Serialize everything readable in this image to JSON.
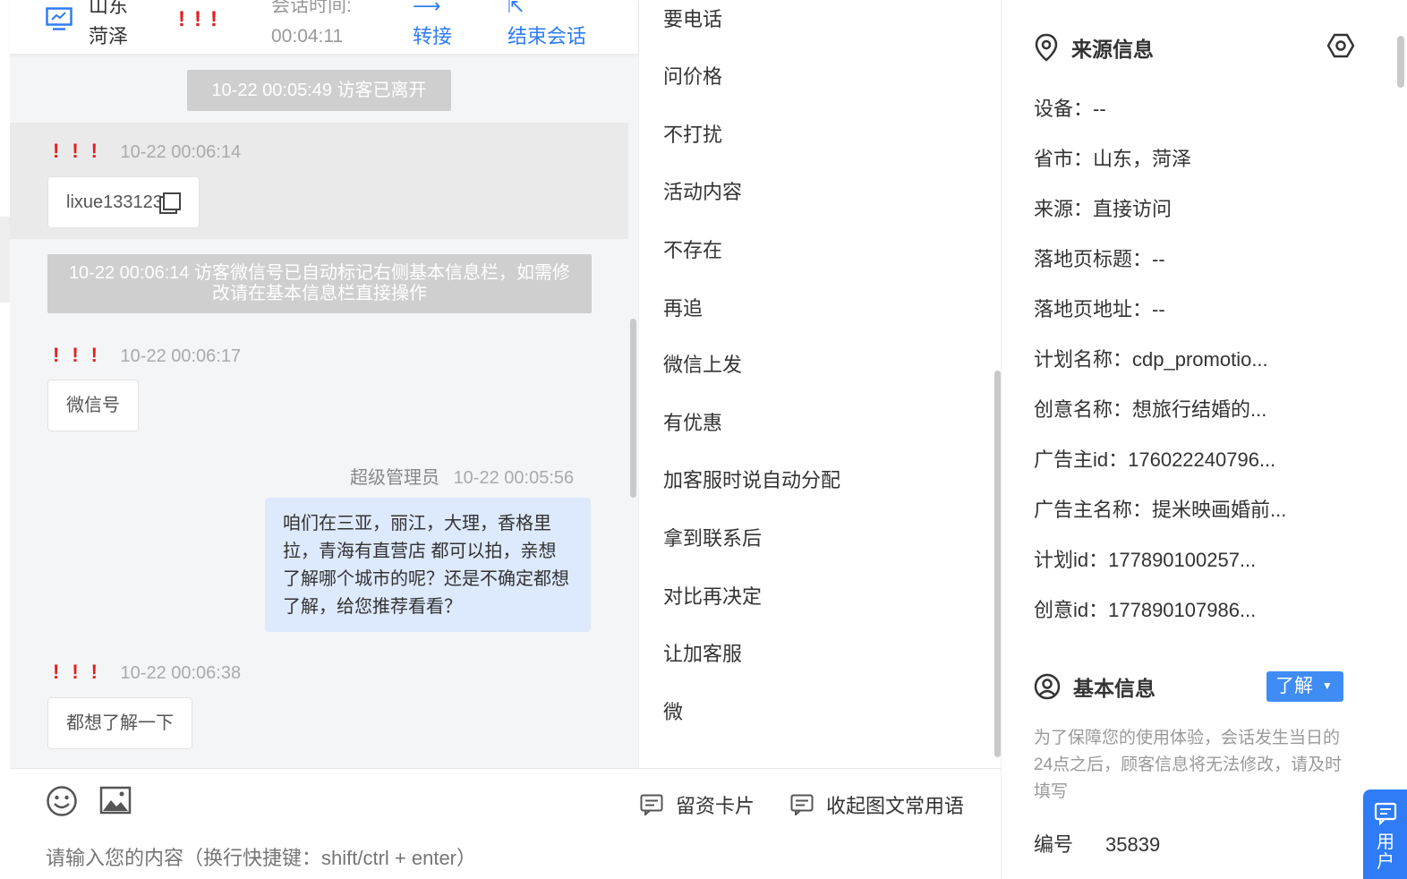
{
  "header": {
    "visitor_name": "山东菏泽",
    "priority_marks": "!!!",
    "session_label": "会话时间:",
    "session_time": "00:04:11",
    "transfer_label": "转接",
    "end_session_label": "结束会话"
  },
  "messages": {
    "sys_left": "10-22 00:05:49 访客已离开",
    "m1_time": "10-22 00:06:14",
    "m1_text": "lixue133123",
    "sys_wechat": "10-22 00:06:14 访客微信号已自动标记右侧基本信息栏，如需修改请在基本信息栏直接操作",
    "m2_time": "10-22 00:06:17",
    "m2_text": "微信号",
    "out_sender": "超级管理员",
    "out_time": "10-22 00:05:56",
    "out_text": "咱们在三亚，丽江，大理，香格里拉，青海有直营店 都可以拍，亲想了解哪个城市的呢？还是不确定都想了解，给您推荐看看？",
    "m3_time": "10-22 00:06:38",
    "m3_text": "都想了解一下"
  },
  "composer": {
    "card_label": "留资卡片",
    "collapse_label": "收起图文常用语",
    "placeholder": "请输入您的内容（换行快捷键：shift/ctrl + enter）"
  },
  "phrases": [
    "要电话",
    "问价格",
    "不打扰",
    "活动内容",
    "不存在",
    "再追",
    "微信上发",
    "有优惠",
    "加客服时说自动分配",
    "拿到联系后",
    "对比再决定",
    "让加客服",
    "微"
  ],
  "source_info": {
    "title": "来源信息",
    "rows": [
      {
        "label": "设备：",
        "value": "--"
      },
      {
        "label": "省市：",
        "value": "山东，菏泽"
      },
      {
        "label": "来源：",
        "value": "直接访问"
      },
      {
        "label": "落地页标题：",
        "value": "--"
      },
      {
        "label": "落地页地址：",
        "value": "--"
      },
      {
        "label": "计划名称：",
        "value": "cdp_promotio..."
      },
      {
        "label": "创意名称：",
        "value": "想旅行结婚的..."
      },
      {
        "label": "广告主id：",
        "value": "176022240796..."
      },
      {
        "label": "广告主名称：",
        "value": "提米映画婚前..."
      },
      {
        "label": "计划id：",
        "value": "177890100257..."
      },
      {
        "label": "创意id：",
        "value": "177890107986..."
      }
    ]
  },
  "basic_info": {
    "title": "基本信息",
    "dropdown_value": "了解",
    "notice": "为了保障您的使用体验，会话发生当日的24点之后，顾客信息将无法修改，请及时填写",
    "id_label": "编号",
    "id_value": "35839"
  },
  "user_tab_label": "用户",
  "colors": {
    "accent": "#2f7cf6",
    "priority": "#e02020",
    "outgoing_bubble": "#dde9fc",
    "system_pill": "#cfcfcf"
  }
}
